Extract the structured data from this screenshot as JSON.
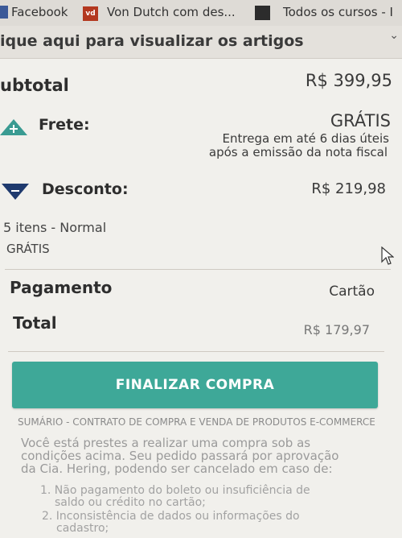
{
  "bookmarks": {
    "facebook": "Facebook",
    "von_dutch": "Von Dutch com des...",
    "todos": "Todos os cursos - I"
  },
  "articles_band": {
    "text": "ique aqui para visualizar os artigos"
  },
  "summary": {
    "subtotal_label": "ubtotal",
    "subtotal_value": "R$ 399,95",
    "frete_label": "Frete:",
    "frete_value": "GRÁTIS",
    "frete_note_line1": "Entrega em até 6 dias úteis",
    "frete_note_line2": "após a emissão da nota fiscal",
    "desconto_label": "Desconto:",
    "desconto_value": "R$ 219,98",
    "items_text": "5 itens - Normal",
    "items_shipping": "GRÁTIS",
    "pagamento_label": "Pagamento",
    "pagamento_value": "Cartão",
    "total_label": "Total",
    "total_value": "R$ 179,97"
  },
  "checkout_button": "FINALIZAR COMPRA",
  "contract": {
    "title": "SUMÁRIO - CONTRATO DE COMPRA E VENDA DE PRODUTOS E-COMMERCE",
    "para_line1": "Você está prestes a realizar uma compra sob as",
    "para_line2": "condições acima. Seu pedido passará por aprovação",
    "para_line3": "da Cia. Hering, podendo ser cancelado em caso de:",
    "item1_line1": "1. Não pagamento do boleto ou insuficiência de",
    "item1_line2": "saldo ou crédito no cartão;",
    "item2_line1": "2. Inconsistência de dados ou informações do",
    "item2_line2": "cadastro;"
  },
  "colors": {
    "accent": "#3ea898",
    "frete_icon": "#3a9b92",
    "desconto_icon": "#1f3a6e"
  },
  "icons": [
    "facebook-icon",
    "von-dutch-icon",
    "bookmark-icon",
    "chevron-down-icon",
    "plus-triangle-icon",
    "minus-triangle-icon",
    "cursor-icon"
  ]
}
